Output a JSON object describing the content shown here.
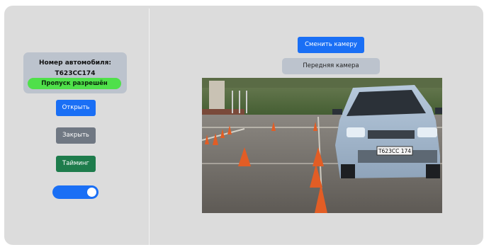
{
  "plate": {
    "title": "Номер автомобиля:",
    "number": "Т623СС174",
    "status": "Пропуск разрешён"
  },
  "controls": {
    "open_label": "Открыть",
    "close_label": "Закрыть",
    "timing_label": "Тайминг",
    "toggle_on": true
  },
  "camera": {
    "switch_label": "Сменить камеру",
    "current_label": "Передняя камера",
    "feed_plate_text": "Т623СС 174"
  },
  "colors": {
    "primary": "#1a6ff5",
    "secondary": "#707883",
    "success": "#1e7c4c",
    "badge": "#4fe04a"
  }
}
